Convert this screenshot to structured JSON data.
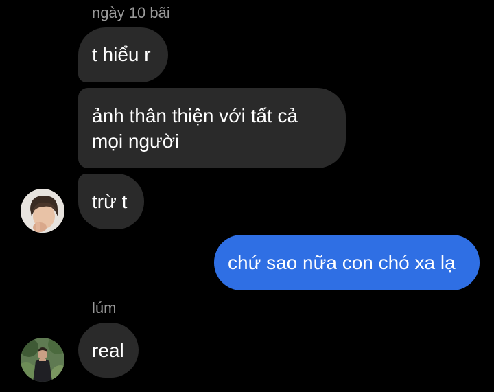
{
  "groups": [
    {
      "sender": "ngày 10 bãi",
      "messages": [
        {
          "lines": [
            "t hiểu r"
          ]
        },
        {
          "lines": [
            "ảnh thân thiện với tất cả",
            "mọi người"
          ]
        },
        {
          "lines": [
            "trừ t"
          ]
        }
      ],
      "avatar_icon": "user-avatar-boy"
    },
    {
      "sender": "",
      "outgoing": true,
      "messages": [
        {
          "lines": [
            "chứ sao nữa con chó xa lạ"
          ]
        }
      ]
    },
    {
      "sender": "lúm",
      "messages": [
        {
          "lines": [
            "real"
          ]
        }
      ],
      "avatar_icon": "user-avatar-outdoor"
    }
  ],
  "colors": {
    "background": "#000000",
    "incoming_bubble": "#2a2a2a",
    "outgoing_bubble": "#2f6fe4",
    "sender_name": "#9a9a9a",
    "text": "#ffffff"
  }
}
